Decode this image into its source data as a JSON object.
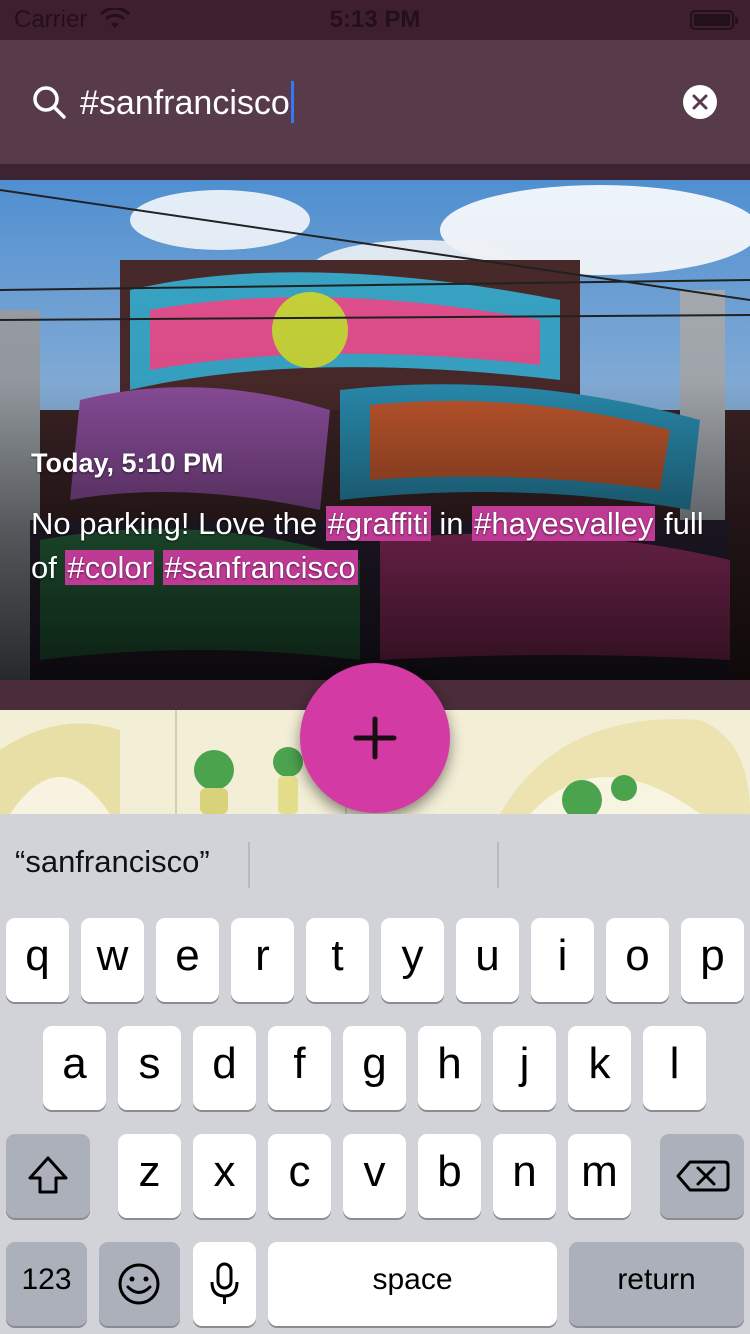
{
  "status_bar": {
    "carrier": "Carrier",
    "time": "5:13 PM"
  },
  "search": {
    "query": "#sanfrancisco"
  },
  "post": {
    "timestamp": "Today, 5:10 PM",
    "caption_parts": [
      {
        "text": "No parking! Love the ",
        "tag": false
      },
      {
        "text": "#graffiti",
        "tag": true
      },
      {
        "text": " in ",
        "tag": false
      },
      {
        "text": "#hayesvalley",
        "tag": true
      },
      {
        "text": " full of ",
        "tag": false
      },
      {
        "text": "#color",
        "tag": true
      },
      {
        "text": " ",
        "tag": false
      },
      {
        "text": "#sanfrancisco",
        "tag": true
      }
    ]
  },
  "fab": {
    "icon": "plus-icon"
  },
  "keyboard": {
    "suggestion": "“sanfrancisco”",
    "row1": [
      "q",
      "w",
      "e",
      "r",
      "t",
      "y",
      "u",
      "i",
      "o",
      "p"
    ],
    "row2": [
      "a",
      "s",
      "d",
      "f",
      "g",
      "h",
      "j",
      "k",
      "l"
    ],
    "row3": [
      "z",
      "x",
      "c",
      "v",
      "b",
      "n",
      "m"
    ],
    "numbers_label": "123",
    "space_label": "space",
    "return_label": "return"
  },
  "colors": {
    "accent": "#d33aa3",
    "tag_highlight": "#bf3a95",
    "header_bg": "#573b4a",
    "background": "#3e2331"
  }
}
